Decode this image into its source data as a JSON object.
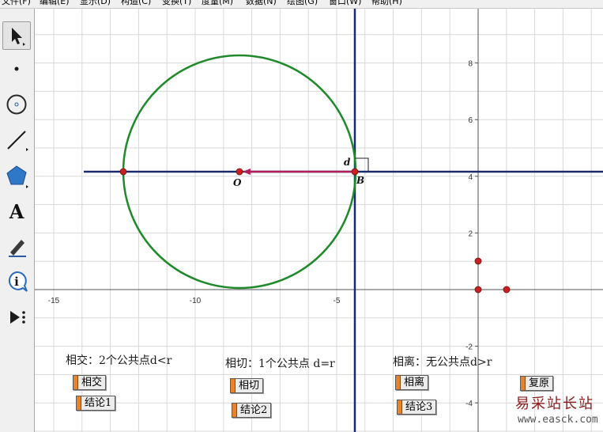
{
  "menu": [
    "文件(F)",
    "编辑(E)",
    "显示(D)",
    "构造(C)",
    "变换(T)",
    "度量(M)",
    "数据(N)",
    "绘图(G)",
    "窗口(W)",
    "帮助(H)"
  ],
  "toolbox": {
    "tools": [
      "arrow-select-icon",
      "point-icon",
      "compass-icon",
      "straightedge-icon",
      "polygon-icon",
      "text-icon",
      "marker-icon",
      "information-icon",
      "custom-tool-icon"
    ],
    "text_tool_glyph": "A",
    "info_tool_glyph": "i"
  },
  "graph": {
    "x_tick_labels": [
      "-15",
      "-10",
      "-5"
    ],
    "y_tick_labels": [
      "8",
      "6",
      "4",
      "2",
      "-2",
      "-4"
    ],
    "labels": {
      "center": "O",
      "tangent_point": "B",
      "distance": "d"
    },
    "colors": {
      "circle": "#1f8a2a",
      "line": "#1a2a6e",
      "segment": "#b0205a",
      "point": "#cc2020",
      "grid": "#d8d8d8",
      "axis_tick_text": "#333333"
    }
  },
  "captions": {
    "intersect": "相交：2个公共点d<r",
    "tangent": "相切：1个公共点 d=r",
    "separate": "相离：无公共点d>r"
  },
  "buttons": {
    "intersect": "相交",
    "conclusion1": "结论1",
    "tangent": "相切",
    "conclusion2": "结论2",
    "separate": "相离",
    "conclusion3": "结论3",
    "reset": "复原"
  },
  "watermark": {
    "zh": "易采站长站",
    "en": "www.easck.com"
  }
}
